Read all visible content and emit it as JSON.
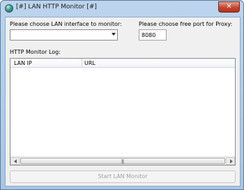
{
  "window": {
    "title": "[#] LAN HTTP Monitor [#]",
    "close_glyph": "✕"
  },
  "form": {
    "interface_label": "Please choose LAN interface to monitor:",
    "interface_value": "",
    "port_label": "Please choose free port for Proxy:",
    "port_value": "8080",
    "log_label": "HTTP Monitor Log:"
  },
  "log": {
    "columns": [
      "LAN IP",
      "URL"
    ],
    "rows": [],
    "scroll_grip": "|||"
  },
  "actions": {
    "start_label": "Start LAN Monitor"
  },
  "icons": {
    "app": "globe-icon",
    "close": "close-icon",
    "combo_arrow": "chevron-down-icon"
  }
}
